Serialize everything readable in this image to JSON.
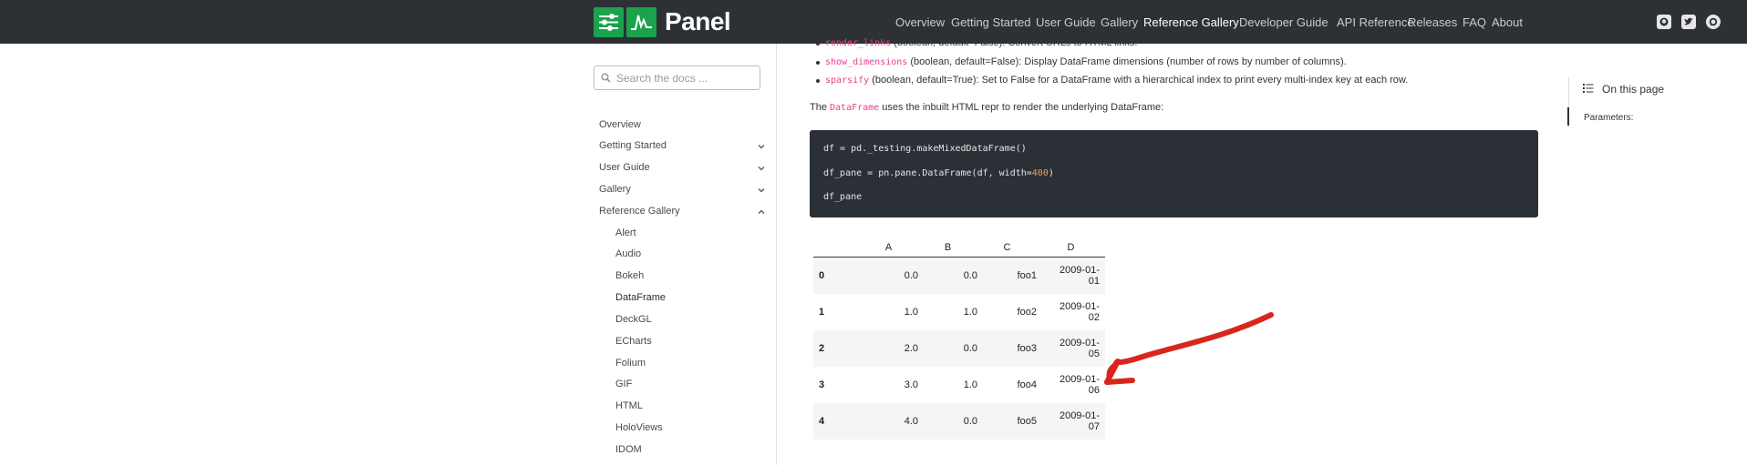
{
  "app": {
    "logo_text": "Panel"
  },
  "nav": {
    "links": [
      "Overview",
      "Getting Started",
      "User Guide",
      "Gallery",
      "Reference Gallery",
      "Developer Guide",
      "API Reference",
      "Releases",
      "FAQ",
      "About"
    ],
    "active": "Reference Gallery",
    "icons": [
      "github-icon",
      "twitter-icon",
      "discourse-icon"
    ]
  },
  "sidebar": {
    "search_placeholder": "Search the docs ...",
    "items": [
      {
        "label": "Overview",
        "level": 0,
        "chevron": "none"
      },
      {
        "label": "Getting Started",
        "level": 0,
        "chevron": "down"
      },
      {
        "label": "User Guide",
        "level": 0,
        "chevron": "down"
      },
      {
        "label": "Gallery",
        "level": 0,
        "chevron": "down"
      },
      {
        "label": "Reference Gallery",
        "level": 0,
        "chevron": "up"
      },
      {
        "label": "Alert",
        "level": 1
      },
      {
        "label": "Audio",
        "level": 1
      },
      {
        "label": "Bokeh",
        "level": 1
      },
      {
        "label": "DataFrame",
        "level": 1,
        "current": true
      },
      {
        "label": "DeckGL",
        "level": 1
      },
      {
        "label": "ECharts",
        "level": 1
      },
      {
        "label": "Folium",
        "level": 1
      },
      {
        "label": "GIF",
        "level": 1
      },
      {
        "label": "HTML",
        "level": 1
      },
      {
        "label": "HoloViews",
        "level": 1
      },
      {
        "label": "IDOM",
        "level": 1
      }
    ]
  },
  "content": {
    "bullets": [
      {
        "code": "render_links",
        "text": " (boolean, default=False): Convert URLs to HTML links."
      },
      {
        "code": "show_dimensions",
        "text": " (boolean, default=False): Display DataFrame dimensions (number of rows by number of columns)."
      },
      {
        "code": "sparsify",
        "text": " (boolean, default=True): Set to False for a DataFrame with a hierarchical index to print every multi-index key at each row."
      }
    ],
    "para_before": "The ",
    "para_code": "DataFrame",
    "para_after": " uses the inbuilt HTML repr to render the underlying DataFrame:",
    "code_lines": [
      "df = pd._testing.makeMixedDataFrame()",
      "df_pane = pn.pane.DataFrame(df, width=",
      "df_pane"
    ],
    "code_width_value": "400",
    "code_line2_end": ")",
    "table": {
      "columns": [
        "",
        "A",
        "B",
        "C",
        "D"
      ],
      "rows": [
        {
          "index": "0",
          "A": "0.0",
          "B": "0.0",
          "C": "foo1",
          "D1": "2009-01-",
          "D2": "01"
        },
        {
          "index": "1",
          "A": "1.0",
          "B": "1.0",
          "C": "foo2",
          "D1": "2009-01-",
          "D2": "02"
        },
        {
          "index": "2",
          "A": "2.0",
          "B": "0.0",
          "C": "foo3",
          "D1": "2009-01-",
          "D2": "05"
        },
        {
          "index": "3",
          "A": "3.0",
          "B": "1.0",
          "C": "foo4",
          "D1": "2009-01-",
          "D2": "06"
        },
        {
          "index": "4",
          "A": "4.0",
          "B": "0.0",
          "C": "foo5",
          "D1": "2009-01-",
          "D2": "07"
        }
      ]
    }
  },
  "toc": {
    "title": "On this page",
    "links": [
      "Parameters:"
    ]
  },
  "colors": {
    "navbar_bg": "#2d3136",
    "brand_green": "#1aa24c",
    "code_bg": "#2b3036",
    "annotation_red": "#d9261c"
  }
}
